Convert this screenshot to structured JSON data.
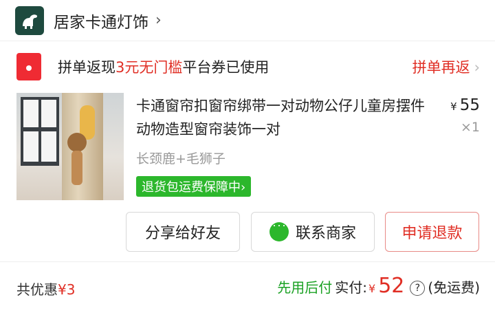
{
  "shop": {
    "name": "居家卡通灯饰",
    "chevron": "›"
  },
  "coupon": {
    "prefix": "拼单返现",
    "amount": "3元无门槛",
    "suffix": "平台券已使用",
    "action": "拼单再返",
    "arrow": "›"
  },
  "product": {
    "title": "卡通窗帘扣窗帘绑带一对动物公仔儿童房摆件动物造型窗帘装饰一对",
    "currency": "¥",
    "price": "55",
    "quantity": "×1",
    "spec": "长颈鹿+毛狮子",
    "guarantee": "退货包运费保障中›"
  },
  "buttons": {
    "share": "分享给好友",
    "contact": "联系商家",
    "refund": "申请退款"
  },
  "footer": {
    "discount_label": "共优惠",
    "discount_value": "¥3",
    "later_pay": "先用后付",
    "paid_label": "实付:",
    "paid_currency": "¥",
    "paid_amount": "52",
    "help_icon": "?",
    "shipping": "(免运费)"
  },
  "colors": {
    "accent_red": "#e02e24",
    "accent_green": "#2cb72c",
    "shop_logo": "#1e4a3f"
  },
  "icons": [
    "dinosaur-logo-icon",
    "red-envelope-icon",
    "chat-bubble-icon",
    "question-circle-icon"
  ]
}
